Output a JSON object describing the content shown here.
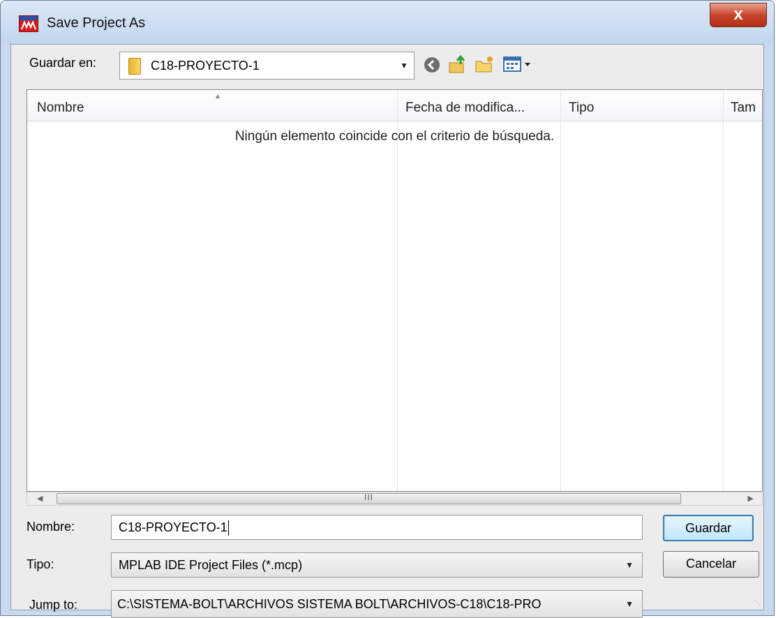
{
  "window": {
    "title": "Save Project As",
    "close_label": "x",
    "app_icon": "mplab-icon",
    "accent_color": "#3c7fb1"
  },
  "location": {
    "label": "Guardar en:",
    "value": "C18-PROYECTO-1"
  },
  "toolbar": {
    "icons": [
      "back-icon",
      "up-folder-icon",
      "new-folder-icon",
      "view-menu-icon"
    ]
  },
  "file_list": {
    "columns": [
      {
        "label": "Nombre"
      },
      {
        "label": "Fecha de modifica..."
      },
      {
        "label": "Tipo"
      },
      {
        "label": "Tam"
      }
    ],
    "empty_message": "Ningún elemento coincide con el criterio de búsqueda."
  },
  "form": {
    "filename_label": "Nombre:",
    "filename_value": "C18-PROYECTO-1",
    "type_label": "Tipo:",
    "type_value": "MPLAB IDE Project Files (*.mcp)",
    "jump_label": "Jump to:",
    "jump_value": "C:\\SISTEMA-BOLT\\ARCHIVOS SISTEMA BOLT\\ARCHIVOS-C18\\C18-PRO"
  },
  "buttons": {
    "save": "Guardar",
    "cancel": "Cancelar"
  }
}
